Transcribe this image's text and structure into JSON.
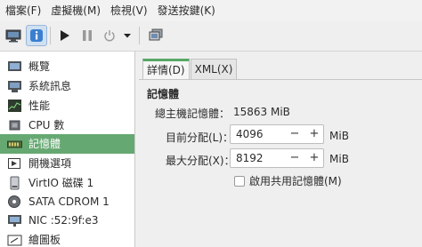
{
  "menubar": {
    "items": [
      "檔案(F)",
      "虛擬機(M)",
      "檢視(V)",
      "發送按鍵(K)"
    ]
  },
  "toolbar": {
    "buttons": [
      {
        "name": "console-icon",
        "active": false
      },
      {
        "name": "details-info-icon",
        "active": true
      },
      {
        "name": "play-icon",
        "active": false
      },
      {
        "name": "pause-icon",
        "active": false
      },
      {
        "name": "power-icon",
        "active": false
      },
      {
        "name": "chevron-down-icon",
        "active": false
      },
      {
        "name": "snapshots-icon",
        "active": false
      }
    ]
  },
  "sidebar": {
    "items": [
      {
        "label": "概覽",
        "icon": "overview-icon"
      },
      {
        "label": "系統訊息",
        "icon": "os-info-icon"
      },
      {
        "label": "性能",
        "icon": "performance-icon"
      },
      {
        "label": "CPU 數",
        "icon": "cpu-icon"
      },
      {
        "label": "記憶體",
        "icon": "memory-icon",
        "selected": true
      },
      {
        "label": "開機選項",
        "icon": "boot-options-icon"
      },
      {
        "label": "VirtIO 磁碟 1",
        "icon": "disk-icon"
      },
      {
        "label": "SATA CDROM 1",
        "icon": "cdrom-icon"
      },
      {
        "label": "NIC :52:9f:e3",
        "icon": "nic-icon"
      },
      {
        "label": "繪圖板",
        "icon": "tablet-icon"
      }
    ]
  },
  "tabs": [
    {
      "label": "詳情(D)",
      "active": true
    },
    {
      "label": "XML(X)",
      "active": false
    }
  ],
  "memory": {
    "section_title": "記憶體",
    "total_label": "總主機記憶體：",
    "total_value": "15863 MiB",
    "current_label": "目前分配(L)：",
    "current_value": "4096",
    "max_label": "最大分配(X)：",
    "max_value": "8192",
    "unit": "MiB",
    "minus": "−",
    "plus": "+",
    "shared_label": "啟用共用記憶體(M)",
    "shared_checked": false
  },
  "colors": {
    "accent": "#66a872",
    "tab_accent": "#57a865"
  }
}
